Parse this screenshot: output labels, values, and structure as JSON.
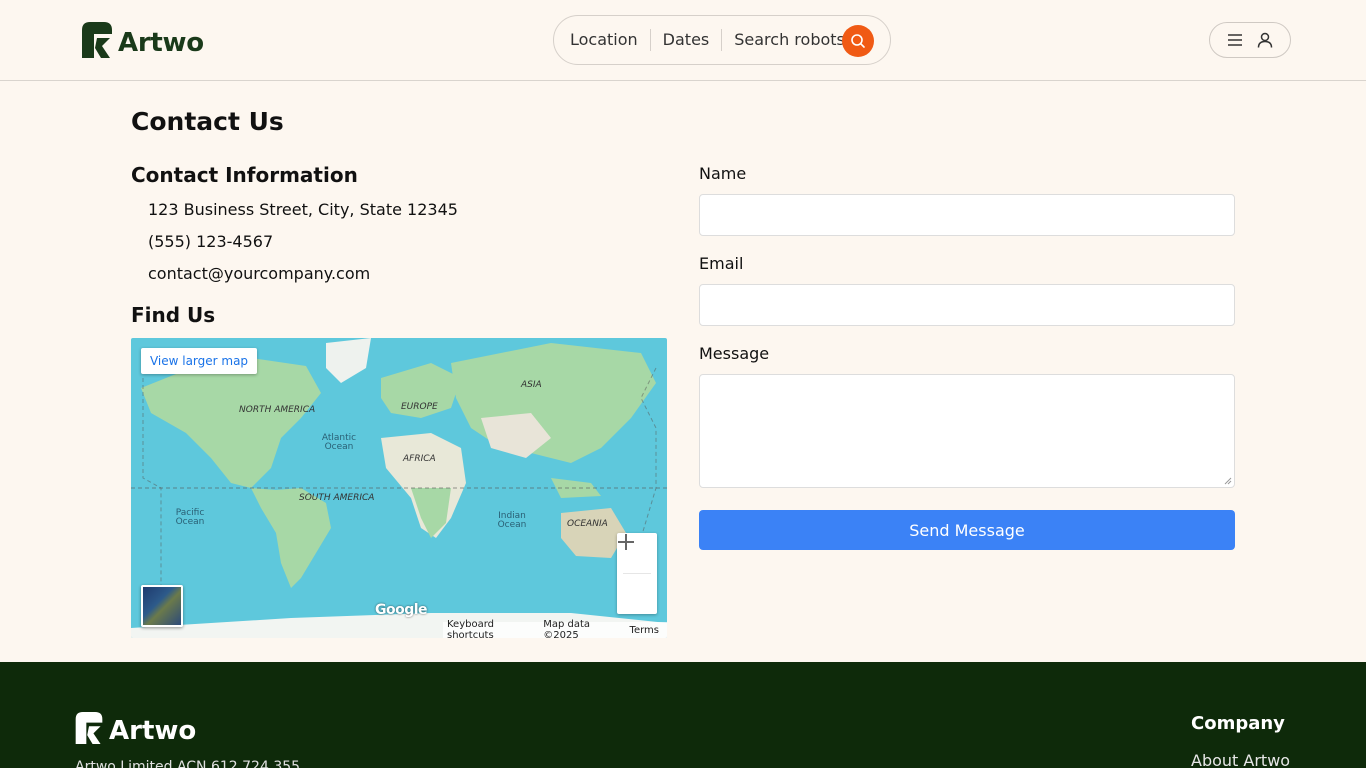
{
  "header": {
    "brand": "Artwo",
    "search": {
      "location": "Location",
      "dates": "Dates",
      "robots": "Search robots"
    }
  },
  "main": {
    "title": "Contact Us",
    "contact_info": {
      "heading": "Contact Information",
      "address": "123 Business Street, City, State 12345",
      "phone": "(555) 123-4567",
      "email": "contact@yourcompany.com"
    },
    "find_us": {
      "heading": "Find Us",
      "view_larger": "View larger map",
      "google": "Google",
      "keyboard": "Keyboard shortcuts",
      "mapdata": "Map data ©2025",
      "terms": "Terms",
      "labels": {
        "north_america": "NORTH AMERICA",
        "south_america": "SOUTH AMERICA",
        "europe": "EUROPE",
        "africa": "AFRICA",
        "asia": "ASIA",
        "oceania": "OCEANIA",
        "atlantic": "Atlantic Ocean",
        "pacific": "Pacific Ocean",
        "indian": "Indian Ocean"
      }
    },
    "form": {
      "name_label": "Name",
      "email_label": "Email",
      "message_label": "Message",
      "submit": "Send Message"
    }
  },
  "footer": {
    "brand": "Artwo",
    "abn": "Artwo Limited ACN 612 724 355",
    "company_heading": "Company",
    "about": "About Artwo"
  },
  "colors": {
    "accent_orange": "#f05a14",
    "button_blue": "#3b82f6",
    "brand_green": "#1a3a1a",
    "footer_bg": "#0e2a0a"
  }
}
